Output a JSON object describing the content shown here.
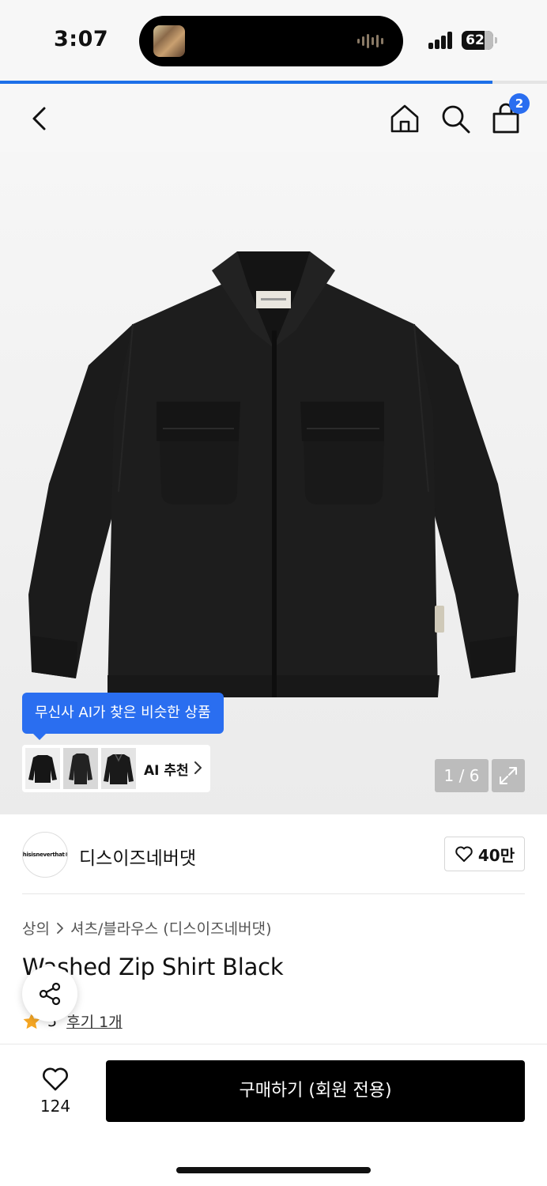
{
  "status_bar": {
    "time": "3:07",
    "battery": "62"
  },
  "page_progress": 0.9,
  "header": {
    "cart_count": "2"
  },
  "ai": {
    "tooltip": "무신사 AI가 찾은 비슷한 상품",
    "recommend_label": "AI 추천"
  },
  "gallery": {
    "counter": "1 / 6"
  },
  "brand": {
    "name": "디스이즈네버댓",
    "logo_text": "thisisneverthat®",
    "likes": "40만"
  },
  "breadcrumb": {
    "category": "상의",
    "subcategory": "셔츠/블라우스 (디스이즈네버댓)"
  },
  "product": {
    "title": "Washed Zip Shirt Black",
    "rating": "5",
    "reviews": "후기 1개"
  },
  "bottom": {
    "wish_count": "124",
    "buy_label": "구매하기 (회원 전용)"
  },
  "colors": {
    "accent": "#2a6ef0",
    "buy_button": "#000000",
    "star": "#f5a623"
  },
  "icons": [
    "back-icon",
    "home-icon",
    "search-icon",
    "cart-icon",
    "expand-icon",
    "heart-icon",
    "share-icon",
    "star-icon",
    "chevron-right-icon"
  ]
}
